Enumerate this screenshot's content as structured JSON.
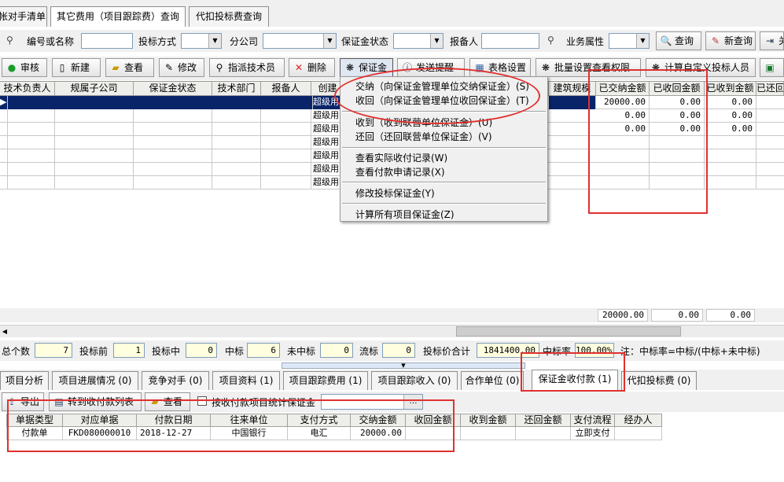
{
  "top_tabs": [
    "帐对手清单",
    "其它费用（项目跟踪费）查询",
    "代扣投标费查询"
  ],
  "filter": {
    "code_label": "编号或名称",
    "bid_method_label": "投标方式",
    "branch_label": "分公司",
    "deposit_status_label": "保证金状态",
    "reporter_label": "报备人",
    "biz_attr_label": "业务属性",
    "query_label": "查询",
    "new_query_label": "新查询",
    "more_label": "关"
  },
  "toolbar": {
    "audit": "审核",
    "new": "新建",
    "view": "查看",
    "edit": "修改",
    "assign": "指派技术员",
    "delete": "删除",
    "deposit": "保证金",
    "send_reminder": "发送提醒",
    "table_settings": "表格设置",
    "batch_permission": "批量设置查看权限",
    "calc_custom": "计算自定义投标人员"
  },
  "grid": {
    "headers": [
      "技术负责人",
      "规属子公司",
      "保证金状态",
      "技术部门",
      "报备人",
      "创建",
      "建筑规模",
      "已交纳金额",
      "已收回金额",
      "已收到金额",
      "已还回"
    ],
    "rows": [
      {
        "creator": "超级用",
        "paid": "20000.00",
        "returned": "0.00",
        "received": "0.00"
      },
      {
        "creator": "超级用",
        "paid": "0.00",
        "returned": "0.00",
        "received": "0.00"
      },
      {
        "creator": "超级用",
        "paid": "0.00",
        "returned": "0.00",
        "received": "0.00"
      },
      {
        "creator": "超级用",
        "paid": "",
        "returned": "",
        "received": ""
      },
      {
        "creator": "超级用",
        "paid": "",
        "returned": "",
        "received": ""
      },
      {
        "creator": "超级用",
        "paid": "",
        "returned": "",
        "received": ""
      },
      {
        "creator": "超级用",
        "paid": "",
        "returned": "",
        "received": ""
      }
    ],
    "totals": {
      "paid": "20000.00",
      "returned": "0.00",
      "received": "0.00"
    }
  },
  "context_menu": [
    "交纳（向保证金管理单位交纳保证金）(S)",
    "收回（向保证金管理单位收回保证金）(T)",
    "收到（收到联营单位保证金）(U)",
    "还回（还回联营单位保证金）(V)",
    "查看实际收付记录(W)",
    "查看付款申请记录(X)",
    "修改投标保证金(Y)",
    "计算所有项目保证金(Z)"
  ],
  "stats": {
    "total_label": "总个数",
    "total": "7",
    "pre_label": "投标前",
    "pre": "1",
    "during_label": "投标中",
    "during": "0",
    "won_label": "中标",
    "won": "6",
    "lost_label": "未中标",
    "lost": "0",
    "failed_label": "流标",
    "failed": "0",
    "price_label": "投标价合计",
    "price": "1841400.00",
    "rate_label": "中标率",
    "rate": "100.00%",
    "note": "注：中标率=中标/(中标+未中标)"
  },
  "bottom_tabs": [
    "项目分析",
    "项目进展情况 (0)",
    "竞争对手 (0)",
    "项目资料 (1)",
    "项目跟踪费用 (1)",
    "项目跟踪收入 (0)",
    "合作单位 (0)",
    "保证金收付款 (1)",
    "代扣投标费 (0)"
  ],
  "bottom_toolbar": {
    "export": "导出",
    "to_list": "转到收付款列表",
    "view": "查看",
    "stat_checkbox": "按收付款项目统计保证金"
  },
  "payments": {
    "headers": [
      "单据类型",
      "对应单据",
      "付款日期",
      "往来单位",
      "支付方式",
      "交纳金额",
      "收回金额",
      "收到金额",
      "还回金额",
      "支付流程",
      "经办人"
    ],
    "rows": [
      [
        "付款单",
        "FKD080000010",
        "2018-12-27",
        "中国银行",
        "电汇",
        "20000.00",
        "",
        "",
        "",
        "立即支付",
        ""
      ]
    ]
  },
  "colors": {
    "selection": "#0a246a",
    "annotation": "#e0312f",
    "stat_box": "#ffffe0"
  }
}
